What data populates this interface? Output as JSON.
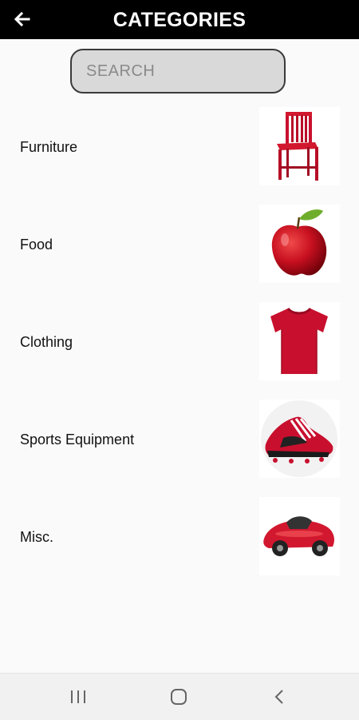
{
  "header": {
    "title": "CATEGORIES",
    "back_icon": "arrow-left-icon"
  },
  "search": {
    "placeholder": "SEARCH",
    "value": ""
  },
  "categories": [
    {
      "label": "Furniture",
      "icon": "chair-icon"
    },
    {
      "label": "Food",
      "icon": "apple-icon"
    },
    {
      "label": "Clothing",
      "icon": "tshirt-icon"
    },
    {
      "label": "Sports Equipment",
      "icon": "soccer-cleat-icon"
    },
    {
      "label": "Misc.",
      "icon": "toy-car-icon"
    }
  ],
  "colors": {
    "header_bg": "#000000",
    "accent_red": "#c8102e",
    "search_bg": "#d9d9d9"
  },
  "nav": {
    "icons": [
      "recent-apps-icon",
      "home-icon",
      "back-icon"
    ]
  }
}
